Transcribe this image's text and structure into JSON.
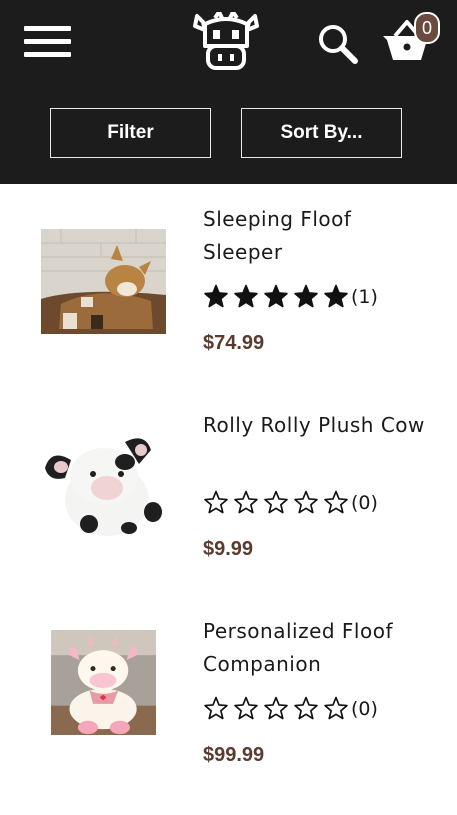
{
  "header": {
    "cart_count": "0",
    "filter_label": "Filter",
    "sort_label": "Sort By..."
  },
  "products": [
    {
      "name": "Sleeping Floof Sleeper",
      "rating": 5,
      "review_count": "(1)",
      "price": "$74.99",
      "image": "plush-cow-sleeper"
    },
    {
      "name": "Rolly Rolly Plush Cow",
      "rating": 0,
      "review_count": "(0)",
      "price": "$9.99",
      "image": "round-plush-cow"
    },
    {
      "name": "Personalized Floof Companion",
      "rating": 0,
      "review_count": "(0)",
      "price": "$99.99",
      "image": "pink-plush-cow"
    }
  ],
  "colors": {
    "header_bg": "#1c1c1c",
    "price": "#5b3b2f",
    "badge": "#6b4b3e"
  },
  "icons": [
    "menu-icon",
    "cow-logo-icon",
    "search-icon",
    "cart-icon",
    "star-icon"
  ]
}
